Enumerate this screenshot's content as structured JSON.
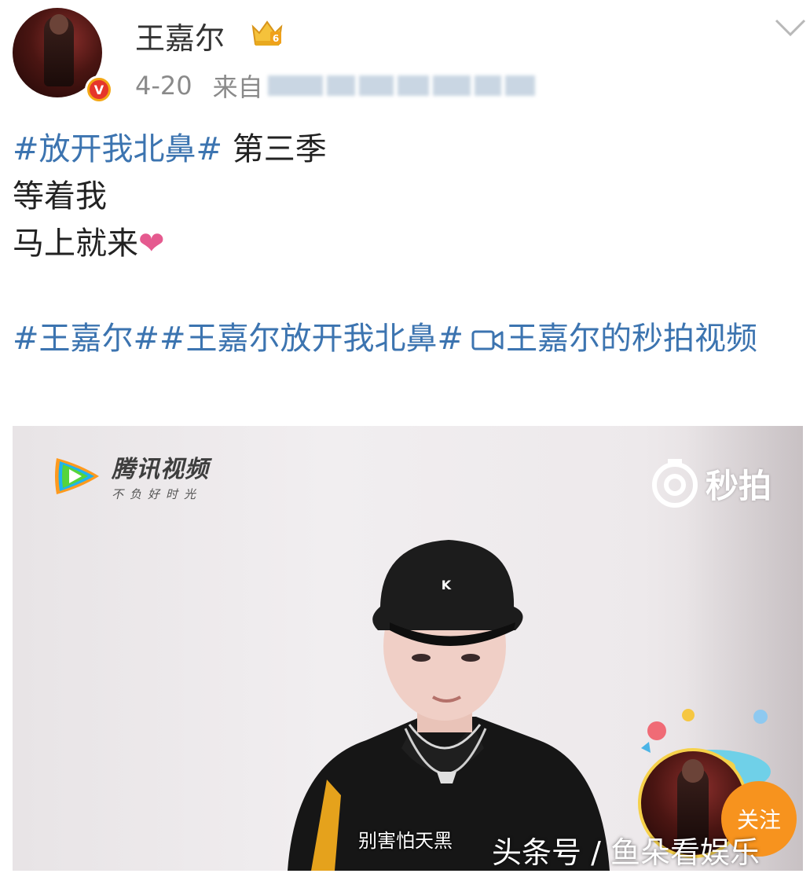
{
  "post": {
    "username": "王嘉尔",
    "date": "4-20",
    "source_prefix": "来自",
    "lines": [
      {
        "topic": "#放开我北鼻#",
        "text": " 第三季"
      },
      {
        "text": "等着我"
      },
      {
        "text": "马上就来",
        "emoji": "❤"
      }
    ],
    "tags": "#王嘉尔##王嘉尔放开我北鼻#",
    "video_link_text": "王嘉尔的秒拍视频"
  },
  "video": {
    "provider_title": "腾讯视频",
    "provider_slogan": "不负好时光",
    "platform_logo": "秒拍",
    "subtitle": "别害怕天黑",
    "follow_label": "关注",
    "watermark": "头条号 / 鱼朵看娱乐"
  },
  "colors": {
    "link": "#3c74b0",
    "meta": "#8a8a8a",
    "follow": "#f7931e",
    "verified": "#e5352a"
  },
  "icons": [
    "verified-v-icon",
    "crown-icon",
    "chevron-down-icon",
    "video-camera-icon",
    "tencent-video-logo-icon",
    "miaopai-logo-icon"
  ]
}
